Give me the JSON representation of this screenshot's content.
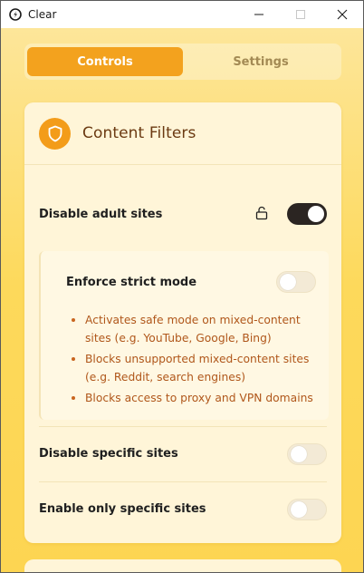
{
  "window": {
    "title": "Clear"
  },
  "tabs": [
    {
      "label": "Controls",
      "active": true
    },
    {
      "label": "Settings",
      "active": false
    }
  ],
  "content_filters": {
    "title": "Content Filters",
    "disable_adult_sites": {
      "label": "Disable adult sites",
      "enabled": true,
      "locked_icon": "lock-open-icon"
    },
    "strict_mode": {
      "label": "Enforce strict mode",
      "enabled": false,
      "bullets": [
        "Activates safe mode on mixed-content sites (e.g. YouTube, Google, Bing)",
        "Blocks unsupported mixed-content sites (e.g. Reddit, search engines)",
        "Blocks access to proxy and VPN domains"
      ]
    },
    "disable_specific_sites": {
      "label": "Disable specific sites",
      "enabled": false
    },
    "enable_only_specific_sites": {
      "label": "Enable only specific sites",
      "enabled": false
    }
  },
  "colors": {
    "accent": "#f3a21e",
    "title_text": "#6b3a12",
    "bullet_text": "#b0571b",
    "toggle_on": "#2b2522"
  }
}
